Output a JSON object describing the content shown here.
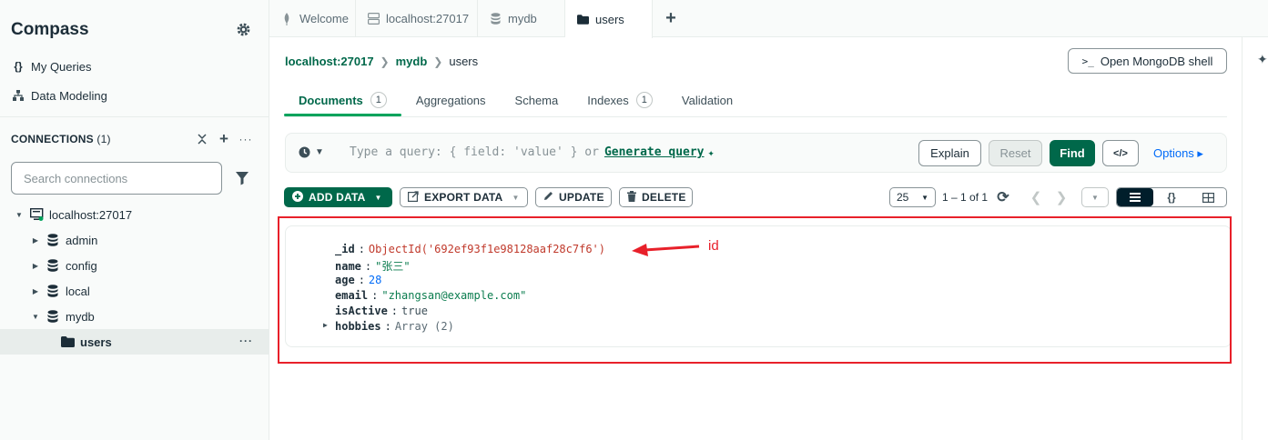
{
  "app": {
    "title": "Compass"
  },
  "sidebar": {
    "nav": [
      {
        "icon": "braces-icon",
        "label": "My Queries"
      },
      {
        "icon": "diagram-icon",
        "label": "Data Modeling"
      }
    ],
    "connections_title": "CONNECTIONS",
    "connections_count": "(1)",
    "search_placeholder": "Search connections",
    "tree": {
      "connection": "localhost:27017",
      "databases": [
        "admin",
        "config",
        "local",
        "mydb"
      ],
      "collection": "users",
      "more": "···"
    }
  },
  "window_tabs": [
    {
      "label": "Welcome",
      "icon": "leaf-icon"
    },
    {
      "label": "localhost:27017",
      "icon": "server-icon"
    },
    {
      "label": "mydb",
      "icon": "database-icon"
    },
    {
      "label": "users",
      "icon": "folder-icon",
      "active": true
    }
  ],
  "add_tab": "+",
  "breadcrumb": [
    "localhost:27017",
    "mydb",
    "users"
  ],
  "shell_button": {
    "icon_text": ">_",
    "label": "Open MongoDB shell"
  },
  "collection_tabs": [
    {
      "label": "Documents",
      "badge": "1",
      "active": true
    },
    {
      "label": "Aggregations"
    },
    {
      "label": "Schema"
    },
    {
      "label": "Indexes",
      "badge": "1"
    },
    {
      "label": "Validation"
    }
  ],
  "query_bar": {
    "placeholder": "Type a query: { field: 'value' } or",
    "generate_link": "Generate query",
    "explain": "Explain",
    "reset": "Reset",
    "find": "Find",
    "code_icon_text": "</>",
    "options": "Options ▸"
  },
  "toolbar": {
    "add_data": "ADD DATA",
    "export_data": "EXPORT DATA",
    "update": "UPDATE",
    "delete": "DELETE",
    "page_size": "25",
    "range": "1 – 1 of 1",
    "views": [
      "list",
      "json",
      "table"
    ]
  },
  "document": {
    "fields": [
      {
        "key": "_id",
        "value": "ObjectId('692ef93f1e98128aaf28c7f6')",
        "type": "oid"
      },
      {
        "key": "name",
        "value": "\"张三\"",
        "type": "str"
      },
      {
        "key": "age",
        "value": "28",
        "type": "num"
      },
      {
        "key": "email",
        "value": "\"zhangsan@example.com\"",
        "type": "str"
      },
      {
        "key": "isActive",
        "value": "true",
        "type": "bool"
      },
      {
        "key": "hobbies",
        "value": "Array (2)",
        "type": "arr"
      }
    ]
  },
  "annotation": {
    "label": "id",
    "color": "#e8202a"
  },
  "colors": {
    "brand_green": "#00684a",
    "accent_green": "#00a35c",
    "link_blue": "#016bf8"
  }
}
